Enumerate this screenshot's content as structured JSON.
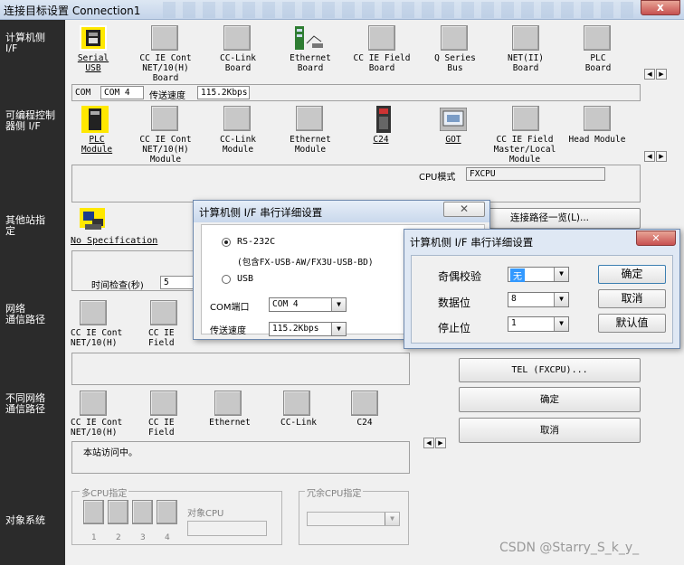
{
  "window": {
    "title": "连接目标设置 Connection1",
    "close": "x"
  },
  "sidebar": {
    "pc_side": "计算机侧\nI/F",
    "plc_side": "可编程控制\n器侧 I/F",
    "other_station": "其他站指\n定",
    "network": "网络\n通信路径",
    "diff_network": "不同网络\n通信路径",
    "target_system": "对象系统"
  },
  "pc_if": {
    "items": [
      {
        "label": "Serial\nUSB",
        "selected": true
      },
      {
        "label": "CC IE Cont\nNET/10(H)\nBoard"
      },
      {
        "label": "CC-Link\nBoard"
      },
      {
        "label": "Ethernet\nBoard"
      },
      {
        "label": "CC IE Field\nBoard"
      },
      {
        "label": "Q Series\nBus"
      },
      {
        "label": "NET(II)\nBoard"
      },
      {
        "label": "PLC\nBoard"
      }
    ],
    "info": {
      "com_label": "COM",
      "com_value": "COM 4",
      "speed_label": "传送速度",
      "speed_value": "115.2Kbps"
    }
  },
  "plc_if": {
    "items": [
      {
        "label": "PLC\nModule",
        "selected": true
      },
      {
        "label": "CC IE Cont\nNET/10(H)\nModule"
      },
      {
        "label": "CC-Link\nModule"
      },
      {
        "label": "Ethernet\nModule"
      },
      {
        "label": "C24"
      },
      {
        "label": "GOT"
      },
      {
        "label": "CC IE Field\nMaster/Local\nModule"
      },
      {
        "label": "Head Module"
      }
    ],
    "cpu_mode_label": "CPU模式",
    "cpu_mode_value": "FXCPU"
  },
  "other_station": {
    "no_spec": "No Specification",
    "time_check_label": "时间检查(秒)",
    "time_check_value": "5"
  },
  "network_route": {
    "items": [
      {
        "label": "CC IE Cont\nNET/10(H)"
      },
      {
        "label": "CC IE\nField"
      }
    ]
  },
  "diff_network": {
    "items": [
      {
        "label": "CC IE Cont\nNET/10(H)"
      },
      {
        "label": "CC IE\nField"
      },
      {
        "label": "Ethernet"
      },
      {
        "label": "CC-Link"
      },
      {
        "label": "C24"
      }
    ],
    "status": "本站访问中。"
  },
  "right_buttons": {
    "route_list": "连接路径一览(L)...",
    "tel": "TEL (FXCPU)...",
    "ok": "确定",
    "cancel": "取消"
  },
  "target_system": {
    "multi_cpu_label": "多CPU指定",
    "target_cpu_label": "对象CPU",
    "cpu_numbers": [
      "1",
      "2",
      "3",
      "4"
    ],
    "redundant_label": "冗余CPU指定"
  },
  "dialog1": {
    "title": "计算机侧 I/F 串行详细设置",
    "rs232c": "RS-232C",
    "rs232c_note": "(包含FX-USB-AW/FX3U-USB-BD)",
    "usb": "USB",
    "com_port_label": "COM端口",
    "com_port_value": "COM 4",
    "speed_label": "传送速度",
    "speed_value": "115.2Kbps"
  },
  "dialog2": {
    "title": "计算机侧 I/F 串行详细设置",
    "parity_label": "奇偶校验",
    "parity_value": "无",
    "databits_label": "数据位",
    "databits_value": "8",
    "stopbits_label": "停止位",
    "stopbits_value": "1",
    "ok": "确定",
    "cancel": "取消",
    "default": "默认值"
  },
  "watermark": "CSDN @Starry_S_k_y_"
}
